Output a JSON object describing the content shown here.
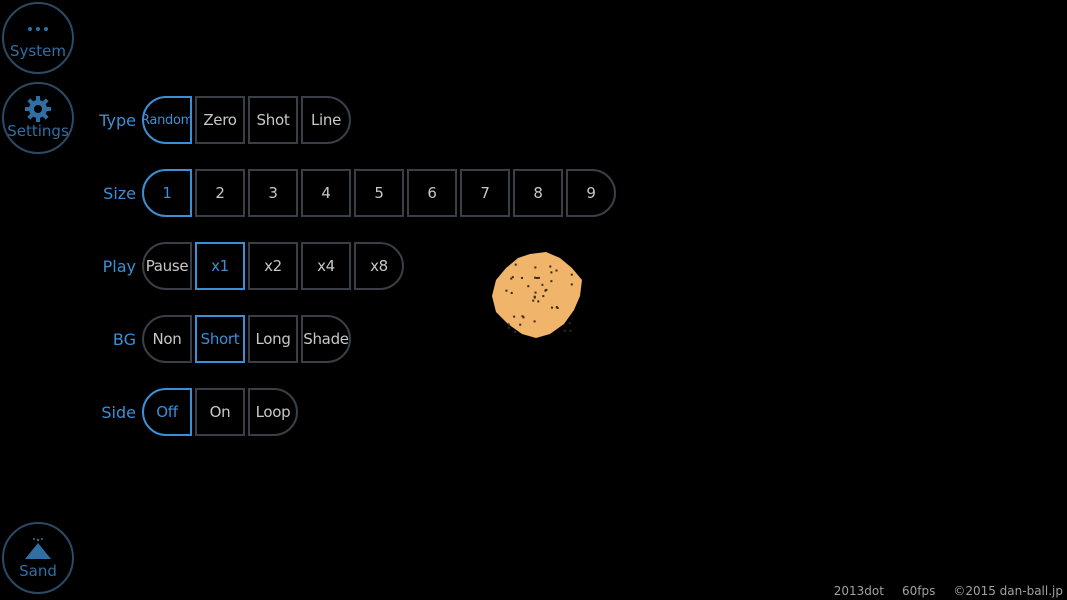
{
  "sidebar": {
    "system_label": "System",
    "system_icon": "ellipsis-icon",
    "settings_label": "Settings",
    "settings_icon": "gear-icon",
    "sand_label": "Sand",
    "sand_icon": "sand-pile-icon"
  },
  "rows": [
    {
      "label": "Type",
      "options": [
        "Random",
        "Zero",
        "Shot",
        "Line"
      ],
      "selected": "Random"
    },
    {
      "label": "Size",
      "options": [
        "1",
        "2",
        "3",
        "4",
        "5",
        "6",
        "7",
        "8",
        "9"
      ],
      "selected": "1"
    },
    {
      "label": "Play",
      "options": [
        "Pause",
        "x1",
        "x2",
        "x4",
        "x8"
      ],
      "selected": "x1"
    },
    {
      "label": "BG",
      "options": [
        "Non",
        "Short",
        "Long",
        "Shade"
      ],
      "selected": "Short"
    },
    {
      "label": "Side",
      "options": [
        "Off",
        "On",
        "Loop"
      ],
      "selected": "Off"
    }
  ],
  "footer": {
    "title": "2013dot",
    "fps": "60fps",
    "copyright": "©2015 dan-ball.jp"
  },
  "colors": {
    "accent": "#3b8fd6",
    "sand": "#f0b46a",
    "background": "#000000"
  }
}
